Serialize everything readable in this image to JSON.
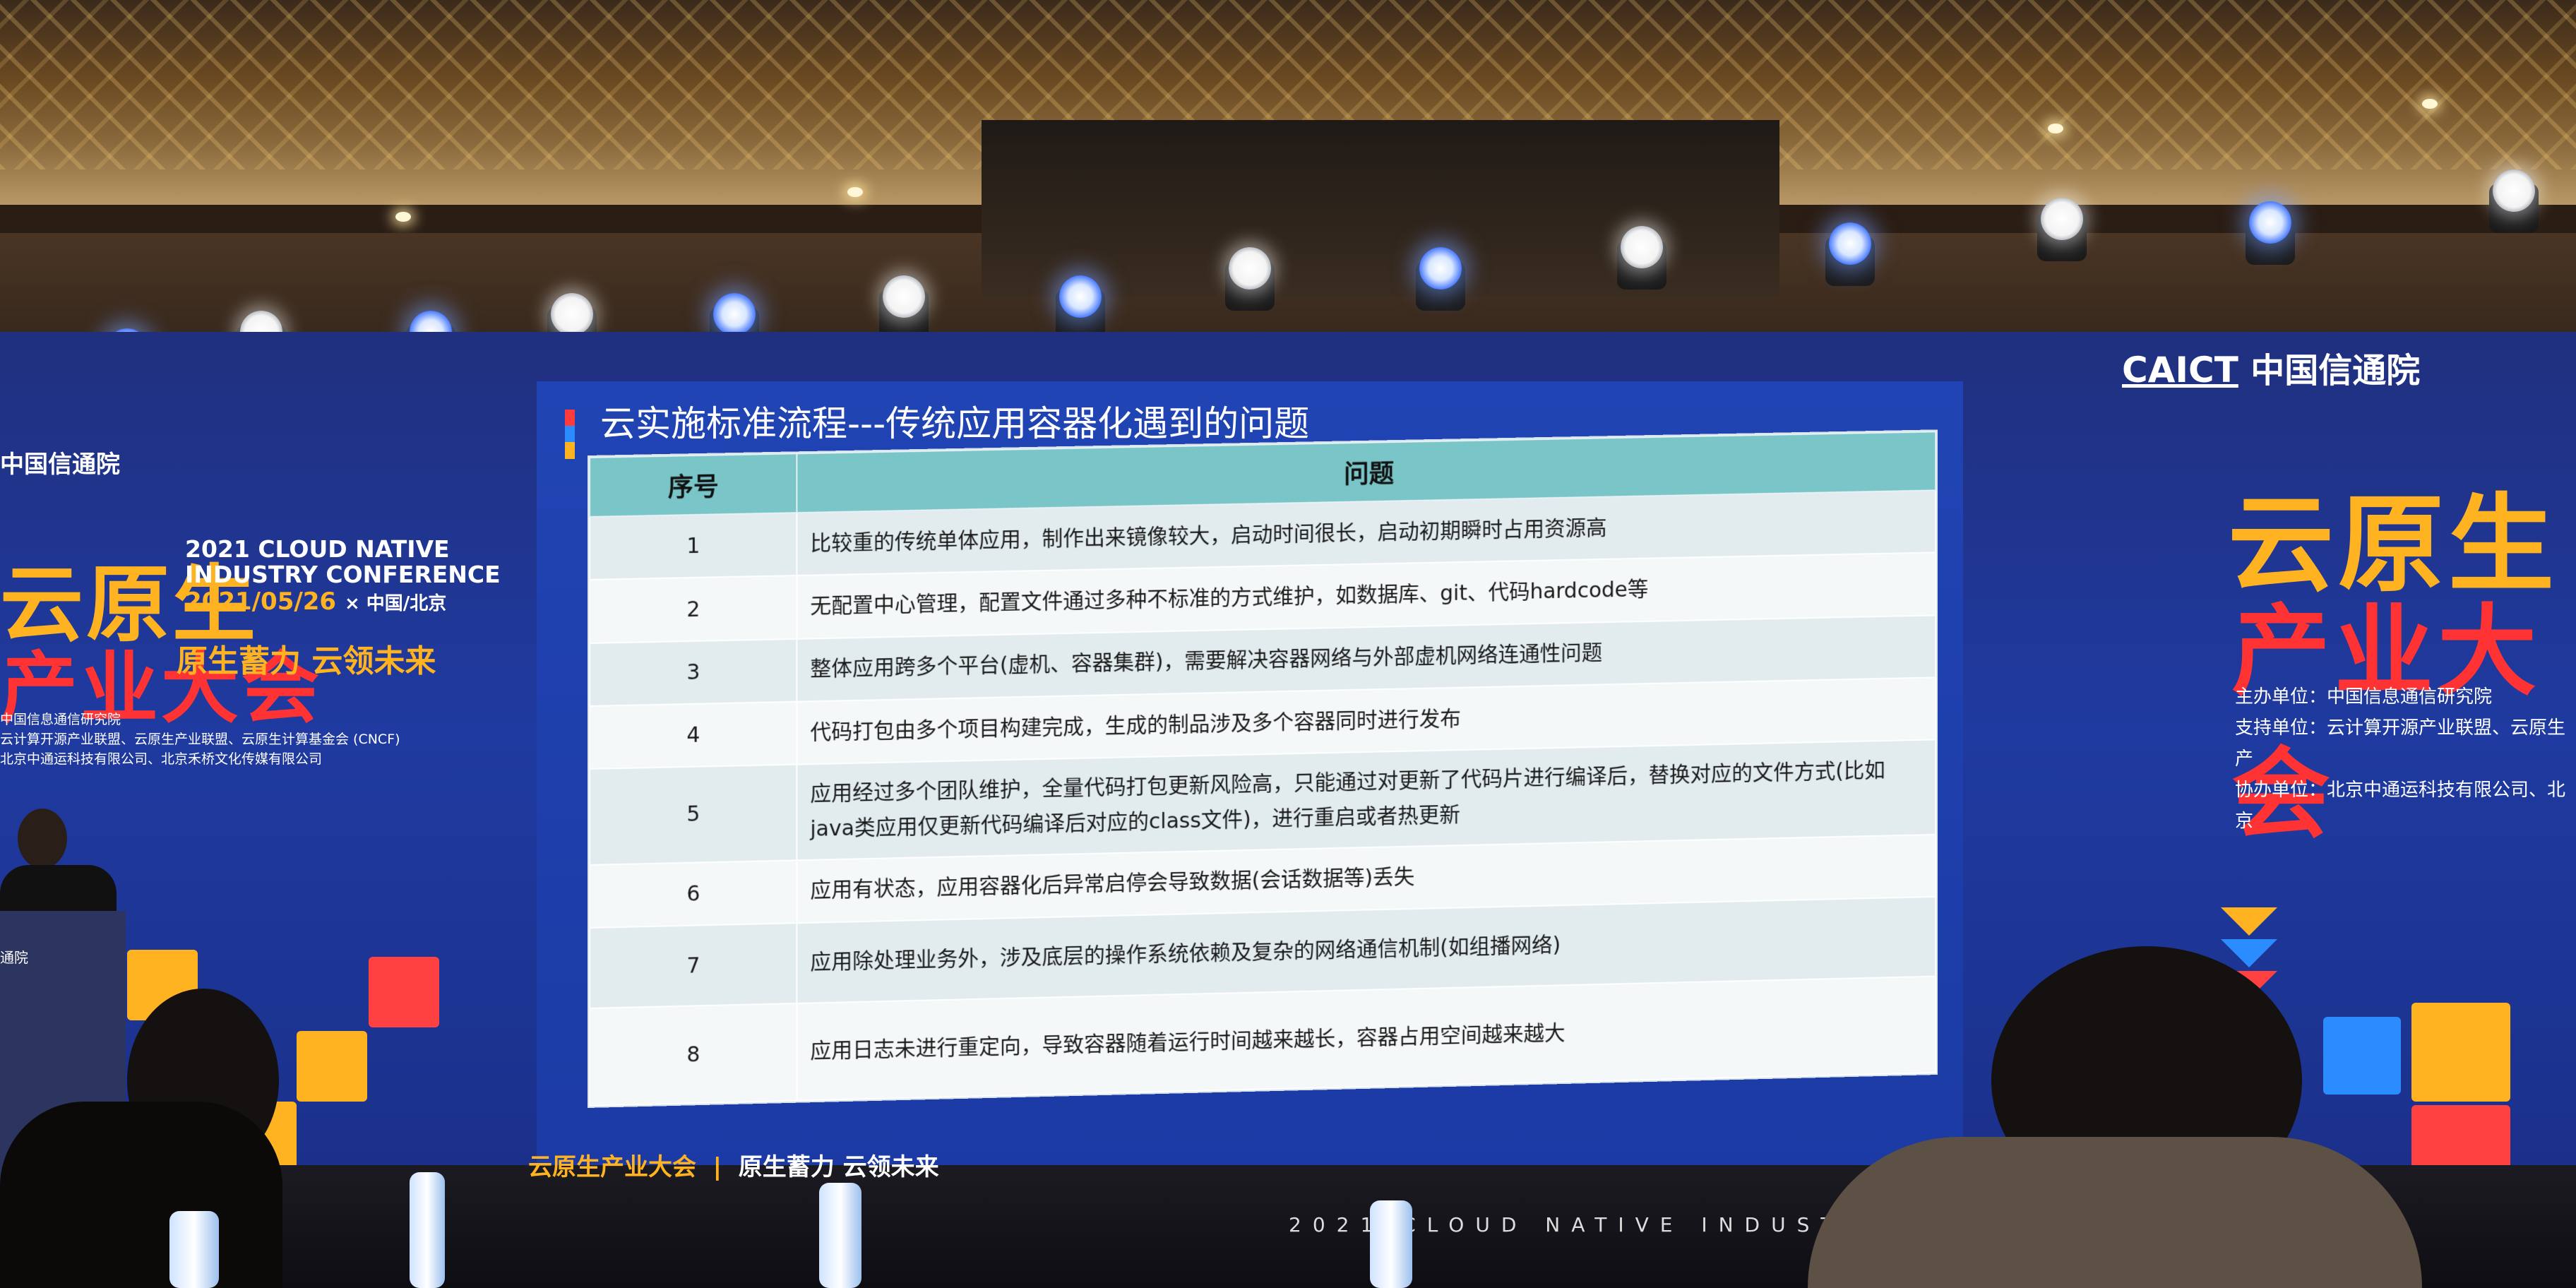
{
  "scene": {
    "slide_title": "云实施标准流程---传统应用容器化遇到的问题",
    "table": {
      "headers": [
        "序号",
        "问题"
      ],
      "rows": [
        {
          "num": "1",
          "text": "比较重的传统单体应用，制作出来镜像较大，启动时间很长，启动初期瞬时占用资源高"
        },
        {
          "num": "2",
          "text": "无配置中心管理，配置文件通过多种不标准的方式维护，如数据库、git、代码hardcode等"
        },
        {
          "num": "3",
          "text": "整体应用跨多个平台(虚机、容器集群)，需要解决容器网络与外部虚机网络连通性问题"
        },
        {
          "num": "4",
          "text": "代码打包由多个项目构建完成，生成的制品涉及多个容器同时进行发布"
        },
        {
          "num": "5",
          "text": "应用经过多个团队维护，全量代码打包更新风险高，只能通过对更新了代码片进行编译后，替换对应的文件方式(比如java类应用仅更新代码编译后对应的class文件)，进行重启或者热更新"
        },
        {
          "num": "6",
          "text": "应用有状态，应用容器化后异常启停会导致数据(会话数据等)丢失"
        },
        {
          "num": "7",
          "text": "应用除处理业务外，涉及底层的操作系统依赖及复杂的网络通信机制(如组播网络)"
        },
        {
          "num": "8",
          "text": "应用日志未进行重定向，导致容器随着运行时间越来越长，容器占用空间越来越大"
        }
      ]
    },
    "left_panel": {
      "brand": "中国信通院",
      "title_line1": "云原生",
      "title_line2": "产业大会",
      "conf_en_1": "2021 CLOUD NATIVE",
      "conf_en_2": "INDUSTRY CONFERENCE",
      "date": "2021/05/26",
      "location": "× 中国/北京",
      "slogan": "原生蓄力 云领未来",
      "hosts": [
        "中国信息通信研究院",
        "云计算开源产业联盟、云原生产业联盟、云原生计算基金会 (CNCF)",
        "北京中通运科技有限公司、北京禾桥文化传媒有限公司"
      ],
      "podium_caption": "通院"
    },
    "right_panel": {
      "brand_en": "CAICT",
      "brand_cn": "中国信通院",
      "title_line1": "云原生",
      "title_line2": "产业大会",
      "hosts": [
        "主办单位：中国信息通信研究院",
        "支持单位：云计算开源产业联盟、云原生产",
        "协办单位：北京中通运科技有限公司、北京"
      ]
    },
    "footer": {
      "left_brand": "云原生产业大会",
      "left_slogan": "原生蓄力 云领未来",
      "english": "2021 CLOUD NATIVE INDUSTRY CO"
    },
    "colors": {
      "screen_blue": "#1f3aa0",
      "accent_orange": "#ffb320",
      "accent_red": "#ff3333",
      "table_header": "#7ac5c8"
    }
  }
}
